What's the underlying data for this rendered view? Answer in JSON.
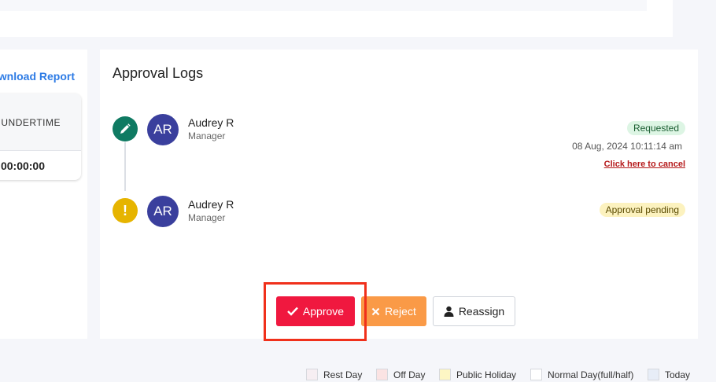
{
  "left_panel": {
    "download_label": "Download Report",
    "undertime_header": "UNDERTIME",
    "undertime_value": "00:00:00"
  },
  "approval": {
    "title": "Approval Logs",
    "logs": [
      {
        "initials": "AR",
        "name": "Audrey R",
        "role": "Manager",
        "status": "Requested",
        "timestamp": "08 Aug, 2024 10:11:14 am",
        "cancel_label": "Click here to cancel"
      },
      {
        "initials": "AR",
        "name": "Audrey R",
        "role": "Manager",
        "status": "Approval pending"
      }
    ]
  },
  "actions": {
    "approve_label": "Approve",
    "reject_label": "Reject",
    "reassign_label": "Reassign"
  },
  "legend": [
    {
      "label": "Rest Day",
      "color": "#f6eef2"
    },
    {
      "label": "Off Day",
      "color": "#fbe3e3"
    },
    {
      "label": "Public Holiday",
      "color": "#fdf6c4"
    },
    {
      "label": "Normal Day(full/half)",
      "color": "#ffffff"
    },
    {
      "label": "Today",
      "color": "#e7edf7"
    }
  ],
  "icons": {
    "edit": "pencil-icon",
    "pending": "exclamation-icon",
    "approve": "check-icon",
    "reject": "x-icon",
    "reassign": "user-icon"
  },
  "colors": {
    "approve": "#f0183f",
    "reject": "#fa9a47",
    "link": "#2d7be5",
    "highlight": "#f0301b"
  }
}
